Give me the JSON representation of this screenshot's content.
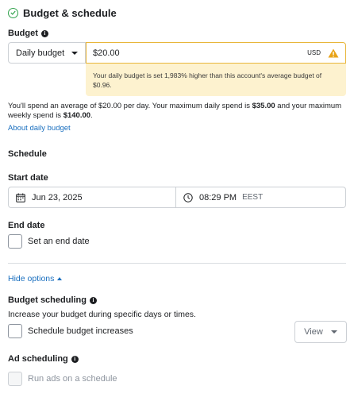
{
  "section": {
    "title": "Budget & schedule"
  },
  "budget": {
    "label": "Budget",
    "type_selected": "Daily budget",
    "amount": "$20.00",
    "currency": "USD",
    "warning": "Your daily budget is set 1,983% higher than this account's average budget of $0.96.",
    "spend_text_1": "You'll spend an average of $20.00 per day. Your maximum daily spend is ",
    "max_daily": "$35.00",
    "spend_text_2": " and your maximum weekly spend is ",
    "max_weekly": "$140.00",
    "spend_text_3": ".",
    "about_link": "About daily budget"
  },
  "schedule": {
    "heading": "Schedule",
    "start_label": "Start date",
    "start_date": "Jun 23, 2025",
    "start_time": "08:29 PM",
    "timezone": "EEST",
    "end_label": "End date",
    "end_checkbox": "Set an end date"
  },
  "options": {
    "toggle": "Hide options"
  },
  "budget_scheduling": {
    "label": "Budget scheduling",
    "description": "Increase your budget during specific days or times.",
    "checkbox": "Schedule budget increases",
    "view_button": "View"
  },
  "ad_scheduling": {
    "label": "Ad scheduling",
    "checkbox": "Run ads on a schedule"
  },
  "colors": {
    "link": "#1a6fbf",
    "warning_bg": "#fdf2cf",
    "warning_border": "#e8b63a",
    "success": "#31a24c"
  }
}
